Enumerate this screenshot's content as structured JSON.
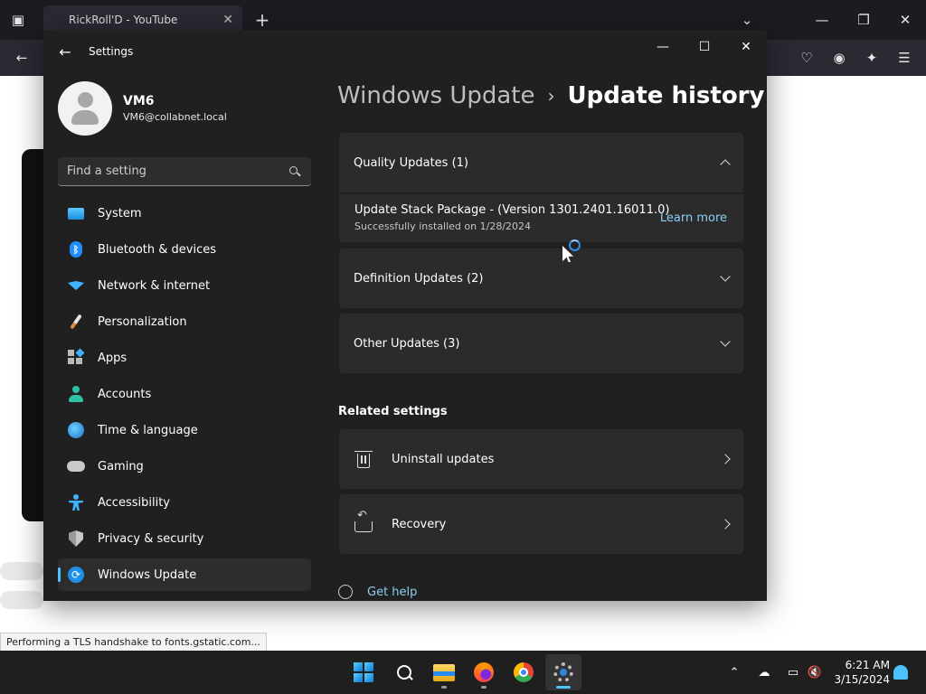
{
  "browser": {
    "tab_title": "RickRoll'D - YouTube",
    "status_tip": "Performing a TLS handshake to fonts.gstatic.com..."
  },
  "settings": {
    "app_title": "Settings",
    "profile": {
      "name": "VM6",
      "email": "VM6@collabnet.local"
    },
    "search_placeholder": "Find a setting",
    "nav": [
      {
        "label": "System",
        "icon": "system-icon"
      },
      {
        "label": "Bluetooth & devices",
        "icon": "bluetooth-icon"
      },
      {
        "label": "Network & internet",
        "icon": "wifi-icon"
      },
      {
        "label": "Personalization",
        "icon": "brush-icon"
      },
      {
        "label": "Apps",
        "icon": "apps-icon"
      },
      {
        "label": "Accounts",
        "icon": "account-icon"
      },
      {
        "label": "Time & language",
        "icon": "globe-clock-icon"
      },
      {
        "label": "Gaming",
        "icon": "gamepad-icon"
      },
      {
        "label": "Accessibility",
        "icon": "accessibility-icon"
      },
      {
        "label": "Privacy & security",
        "icon": "shield-icon"
      },
      {
        "label": "Windows Update",
        "icon": "windows-update-icon",
        "active": true
      }
    ],
    "breadcrumb": {
      "parent": "Windows Update",
      "separator": "›",
      "current": "Update history"
    },
    "groups": {
      "quality": "Quality Updates (1)",
      "definition": "Definition Updates (2)",
      "other": "Other Updates (3)"
    },
    "quality_item": {
      "title": "Update Stack Package - (Version 1301.2401.16011.0)",
      "status": "Successfully installed on 1/28/2024",
      "link": "Learn more"
    },
    "related_title": "Related settings",
    "related": {
      "uninstall": "Uninstall updates",
      "recovery": "Recovery"
    },
    "get_help": "Get help",
    "accent_color": "#4cc2ff"
  },
  "taskbar": {
    "time": "6:21 AM",
    "date": "3/15/2024"
  }
}
